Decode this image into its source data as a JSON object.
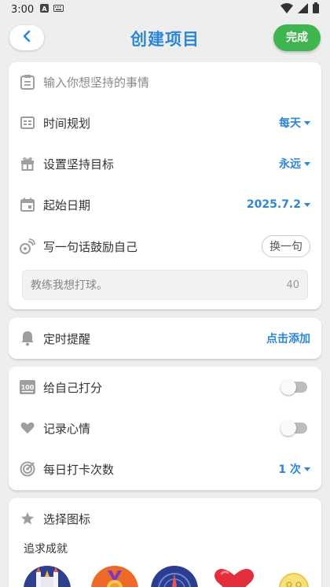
{
  "status_bar": {
    "time": "3:00"
  },
  "header": {
    "title": "创建项目",
    "done_label": "完成"
  },
  "form": {
    "goal_placeholder": "输入你想坚持的事情",
    "schedule": {
      "label": "时间规划",
      "value": "每天"
    },
    "target": {
      "label": "设置坚持目标",
      "value": "永远"
    },
    "start_date": {
      "label": "起始日期",
      "value": "2025.7.2"
    },
    "motto": {
      "label": "写一句话鼓励自己",
      "swap_label": "换一句",
      "value": "教练我想打球。",
      "count": "40"
    }
  },
  "reminder": {
    "label": "定时提醒",
    "action": "点击添加"
  },
  "options": {
    "score": {
      "label": "给自己打分"
    },
    "mood": {
      "label": "记录心情"
    },
    "daily_checkins": {
      "label": "每日打卡次数",
      "value": "1 次"
    }
  },
  "icons": {
    "label": "选择图标",
    "category": "追求成就",
    "items": [
      "castle-icon",
      "medal-icon",
      "compass-icon",
      "heart-icon",
      "smiley-icon"
    ]
  },
  "colors": {
    "accent": "#2d86d6",
    "done_green": "#3fb54f",
    "background": "#eeeeee"
  }
}
